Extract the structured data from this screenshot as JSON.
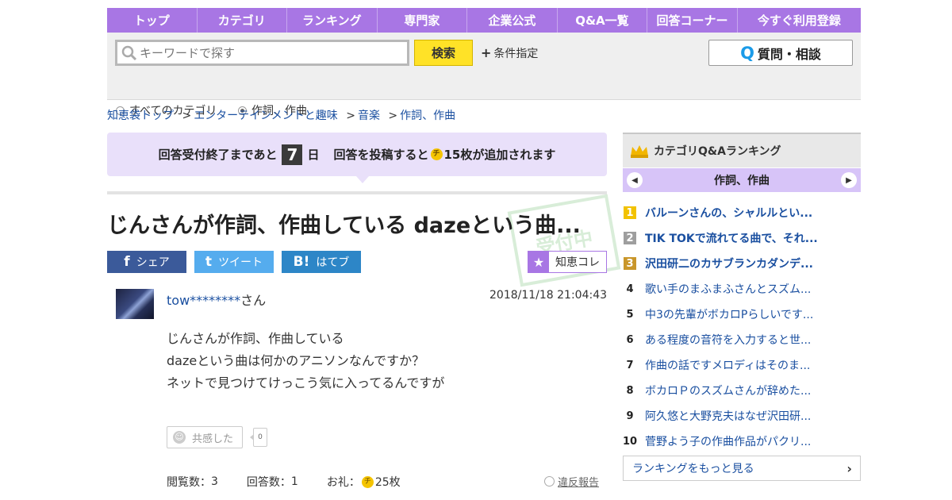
{
  "nav": [
    "トップ",
    "カテゴリ",
    "ランキング",
    "専門家",
    "企業公式",
    "Q&A一覧",
    "回答コーナー",
    "今すぐ利用登録"
  ],
  "search": {
    "placeholder": "キーワードで探す",
    "button": "検索",
    "conditions": "条件指定",
    "ask_button": "質問・相談",
    "ask_q": "Q"
  },
  "scope": {
    "all_label": "すべてのカテゴリ",
    "current_label": "作詞、作曲",
    "selected": "current"
  },
  "breadcrumb": [
    {
      "label": "知恵袋トップ",
      "sep": ""
    },
    {
      "label": "エンターテインメントと趣味",
      "sep": ">"
    },
    {
      "label": "音楽",
      "sep": ">"
    },
    {
      "label": "作詞、作曲",
      "sep": ">"
    }
  ],
  "banner": {
    "prefix": "回答受付終了まであと",
    "days": "7",
    "unit": "日",
    "middle": "回答を投稿すると",
    "coin": "チ",
    "suffix": "15枚が追加されます"
  },
  "question": {
    "title": "じんさんが作詞、作曲している dazeという曲...",
    "stamp": "受付中",
    "user": "tow********",
    "honorific": "さん",
    "date": "2018/11/18  21:04:43",
    "body": [
      "じんさんが作詞、作曲している",
      "dazeという曲は何かのアニソンなんですか？",
      "ネットで見つけてけっこう気に入ってるんですが"
    ],
    "sympathy_label": "共感した",
    "sympathy_count": "0",
    "views_label": "閲覧数：",
    "views": "3",
    "answers_label": "回答数：",
    "answers": "1",
    "reward_label": "お礼：",
    "reward_coin": "チ",
    "reward": "25枚",
    "report": "違反報告"
  },
  "share": {
    "facebook": {
      "icon": "f",
      "label": "シェア",
      "color": "#3b5a9a"
    },
    "twitter": {
      "icon": "t",
      "label": "ツイート",
      "color": "#55acee"
    },
    "hatena": {
      "icon": "B!",
      "label": "はてブ",
      "color": "#2d86c7"
    },
    "collect": {
      "icon": "★",
      "label": "知恵コレ"
    }
  },
  "ranking": {
    "title": "カテゴリQ&Aランキング",
    "category": "作詞、作曲",
    "items": [
      "バルーンさんの、シャルルとい...",
      "TIK TOKで流れてる曲で、それ...",
      "沢田研二のカサブランカダンデ...",
      "歌い手のまふまふさんとスズム...",
      "中3の先輩がボカロPらしいです...",
      "ある程度の音符を入力すると世...",
      "作曲の話ですメロディはそのま...",
      "ボカロＰのスズムさんが辞めた...",
      "阿久悠と大野克夫はなぜ沢田研...",
      "菅野よう子の作曲作品がパクリ..."
    ],
    "more": "ランキングをもっと見る"
  }
}
